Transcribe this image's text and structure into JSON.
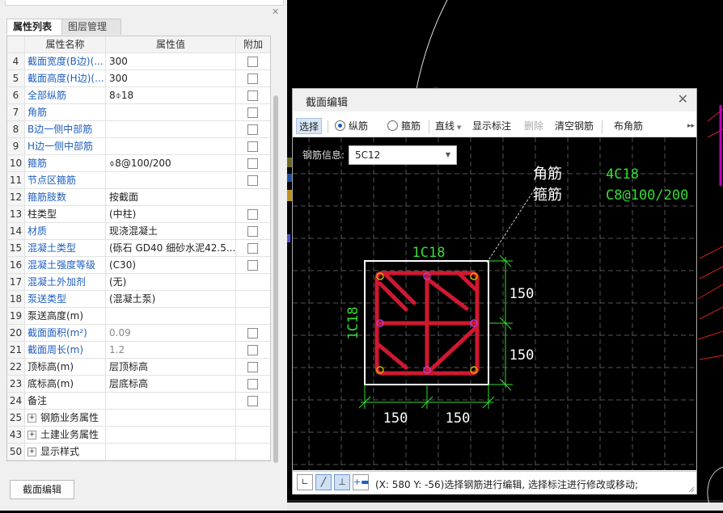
{
  "panel": {
    "tabs": [
      "属性列表",
      "图层管理"
    ],
    "columns": [
      "属性名称",
      "属性值",
      "附加"
    ],
    "rows": [
      {
        "num": "4",
        "name": "截面宽度(B边)(...",
        "value": "300",
        "name_blue": true,
        "value_grey": false,
        "check": true,
        "expand": false
      },
      {
        "num": "5",
        "name": "截面高度(H边)(...",
        "value": "300",
        "name_blue": true,
        "value_grey": false,
        "check": true,
        "expand": false
      },
      {
        "num": "6",
        "name": "全部纵筋",
        "value": "8⌽18",
        "name_blue": true,
        "value_grey": false,
        "check": true,
        "expand": false
      },
      {
        "num": "7",
        "name": "角筋",
        "value": "",
        "name_blue": true,
        "value_grey": false,
        "check": true,
        "expand": false
      },
      {
        "num": "8",
        "name": "B边一侧中部筋",
        "value": "",
        "name_blue": true,
        "value_grey": false,
        "check": true,
        "expand": false
      },
      {
        "num": "9",
        "name": "H边一侧中部筋",
        "value": "",
        "name_blue": true,
        "value_grey": false,
        "check": true,
        "expand": false
      },
      {
        "num": "10",
        "name": "箍筋",
        "value": "⌽8@100/200",
        "name_blue": true,
        "value_grey": false,
        "check": true,
        "expand": false
      },
      {
        "num": "11",
        "name": "节点区箍筋",
        "value": "",
        "name_blue": true,
        "value_grey": false,
        "check": true,
        "expand": false
      },
      {
        "num": "12",
        "name": "箍筋肢数",
        "value": "按截面",
        "name_blue": true,
        "value_grey": false,
        "check": false,
        "expand": false
      },
      {
        "num": "13",
        "name": "柱类型",
        "value": "(中柱)",
        "name_blue": false,
        "value_grey": false,
        "check": true,
        "expand": false
      },
      {
        "num": "14",
        "name": "材质",
        "value": "现浇混凝土",
        "name_blue": true,
        "value_grey": false,
        "check": true,
        "expand": false
      },
      {
        "num": "15",
        "name": "混凝土类型",
        "value": "(砾石 GD40 细砂水泥42.5...",
        "name_blue": true,
        "value_grey": false,
        "check": true,
        "expand": false
      },
      {
        "num": "16",
        "name": "混凝土强度等级",
        "value": "(C30)",
        "name_blue": true,
        "value_grey": false,
        "check": true,
        "expand": false
      },
      {
        "num": "17",
        "name": "混凝土外加剂",
        "value": "(无)",
        "name_blue": true,
        "value_grey": false,
        "check": false,
        "expand": false
      },
      {
        "num": "18",
        "name": "泵送类型",
        "value": "(混凝土泵)",
        "name_blue": true,
        "value_grey": false,
        "check": false,
        "expand": false
      },
      {
        "num": "19",
        "name": "泵送高度(m)",
        "value": "",
        "name_blue": false,
        "value_grey": false,
        "check": false,
        "expand": false
      },
      {
        "num": "20",
        "name": "截面面积(m²)",
        "value": "0.09",
        "name_blue": true,
        "value_grey": true,
        "check": true,
        "expand": false
      },
      {
        "num": "21",
        "name": "截面周长(m)",
        "value": "1.2",
        "name_blue": true,
        "value_grey": true,
        "check": true,
        "expand": false
      },
      {
        "num": "22",
        "name": "顶标高(m)",
        "value": "层顶标高",
        "name_blue": false,
        "value_grey": false,
        "check": true,
        "expand": false
      },
      {
        "num": "23",
        "name": "底标高(m)",
        "value": "层底标高",
        "name_blue": false,
        "value_grey": false,
        "check": true,
        "expand": false
      },
      {
        "num": "24",
        "name": "备注",
        "value": "",
        "name_blue": false,
        "value_grey": false,
        "check": true,
        "expand": false
      },
      {
        "num": "25",
        "name": "钢筋业务属性",
        "value": "",
        "name_blue": false,
        "value_grey": false,
        "check": false,
        "expand": true
      },
      {
        "num": "43",
        "name": "土建业务属性",
        "value": "",
        "name_blue": false,
        "value_grey": false,
        "check": false,
        "expand": true
      },
      {
        "num": "50",
        "name": "显示样式",
        "value": "",
        "name_blue": false,
        "value_grey": false,
        "check": false,
        "expand": true
      }
    ],
    "section_edit_button": "截面编辑"
  },
  "dialog": {
    "title": "截面编辑",
    "toolbar": {
      "select": "选择",
      "longitudinal": "纵筋",
      "stirrup": "箍筋",
      "line": "直线",
      "show_annotation": "显示标注",
      "delete": "删除",
      "clear_rebar": "清空钢筋",
      "place_corner": "布角筋"
    },
    "rebar_info_label": "钢筋信息:",
    "rebar_info_value": "5C12",
    "drawing": {
      "corner_label": "角筋",
      "stirrup_label": "箍筋",
      "corner_value": "4C18",
      "stirrup_value": "C8@100/200",
      "top_rebar": "1C18",
      "left_rebar": "1C18",
      "dim_right_top": "150",
      "dim_right_bottom": "150",
      "dim_bottom_left": "150",
      "dim_bottom_right": "150"
    },
    "status_text": "(X: 580 Y: -56)选择钢筋进行编辑, 选择标注进行修改或移动;"
  },
  "colors": {
    "rebar": "#d01830",
    "annotation": "#33dd33",
    "dim_text": "#ffffff",
    "name_blue": "#1f5fbf"
  }
}
